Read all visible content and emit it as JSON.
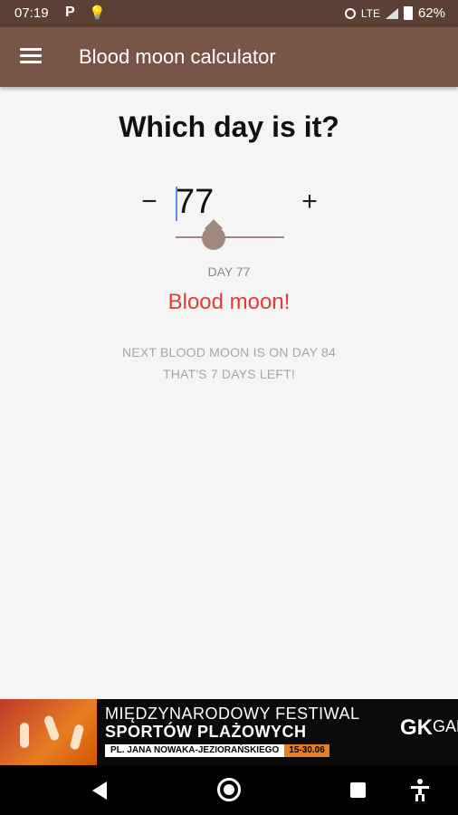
{
  "status_bar": {
    "time": "07:19",
    "network": "LTE",
    "battery": "62%"
  },
  "app_bar": {
    "title": "Blood moon calculator"
  },
  "main": {
    "heading": "Which day is it?",
    "minus_label": "−",
    "plus_label": "+",
    "day_value": "77",
    "slider_level": 0.35,
    "day_label": "DAY 77",
    "status_text": "Blood moon!",
    "next_line1": "NEXT BLOOD MOON IS ON DAY 84",
    "next_line2": "THAT'S 7 DAYS LEFT!"
  },
  "ad": {
    "line1": "MIĘDZYNARODOWY FESTIWAL",
    "line2": "SPORTÓW PLAŻOWYCH",
    "address": "PL. JANA NOWAKA-JEZIORAŃSKIEGO",
    "dates": "15-30.06",
    "logo": "GK",
    "logo_text": "GAL"
  },
  "colors": {
    "app_bar": "#795548",
    "status_bar": "#5b4035",
    "blood_moon_red": "#e53935",
    "slider": "#a1887f"
  }
}
